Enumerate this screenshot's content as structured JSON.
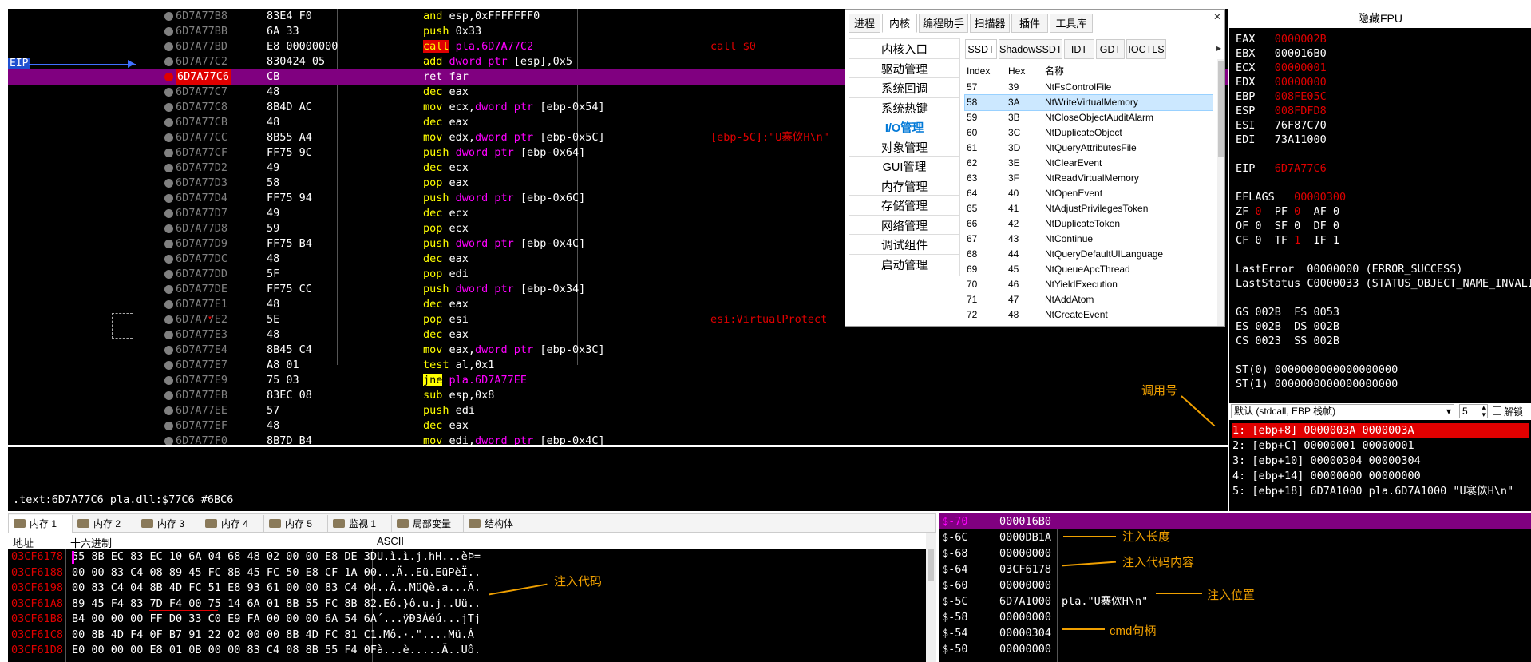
{
  "disasm": {
    "eip_label": "EIP",
    "rows": [
      {
        "addr": "6D7A77B8",
        "bytes": "83E4 F0",
        "asm": [
          [
            "kw",
            "and "
          ],
          [
            "",
            "esp,0xFFFFFFF0"
          ]
        ],
        "cmt": ""
      },
      {
        "addr": "6D7A77BB",
        "bytes": "6A 33",
        "asm": [
          [
            "kw",
            "push "
          ],
          [
            "",
            "0x33"
          ]
        ],
        "cmt": ""
      },
      {
        "addr": "6D7A77BD",
        "bytes": "E8 00000000",
        "asm": [
          [
            "kwbg",
            "call"
          ],
          [
            "",
            " "
          ],
          [
            "addrc",
            "pla.6D7A77C2"
          ]
        ],
        "cmt": "call $0"
      },
      {
        "addr": "6D7A77C2",
        "bytes": "830424 05",
        "asm": [
          [
            "kw",
            "add "
          ],
          [
            "reg",
            "dword ptr "
          ],
          [
            "",
            "[esp],0x5"
          ]
        ],
        "cmt": ""
      },
      {
        "addr": "6D7A77C6",
        "bytes": "CB",
        "asm": [
          [
            "kwpurp",
            "ret far"
          ]
        ],
        "cmt": "",
        "sel": true,
        "cur": true
      },
      {
        "addr": "6D7A77C7",
        "bytes": "48",
        "asm": [
          [
            "kw",
            "dec "
          ],
          [
            "",
            "eax"
          ]
        ],
        "cmt": ""
      },
      {
        "addr": "6D7A77C8",
        "bytes": "8B4D AC",
        "asm": [
          [
            "kw",
            "mov "
          ],
          [
            "",
            "ecx,"
          ],
          [
            "reg",
            "dword ptr "
          ],
          [
            "",
            "[ebp-0x54]"
          ]
        ],
        "cmt": ""
      },
      {
        "addr": "6D7A77CB",
        "bytes": "48",
        "asm": [
          [
            "kw",
            "dec "
          ],
          [
            "",
            "eax"
          ]
        ],
        "cmt": ""
      },
      {
        "addr": "6D7A77CC",
        "bytes": "8B55 A4",
        "asm": [
          [
            "kw",
            "mov "
          ],
          [
            "",
            "edx,"
          ],
          [
            "reg",
            "dword ptr "
          ],
          [
            "",
            "[ebp-0x5C]"
          ]
        ],
        "cmt": "[ebp-5C]:\"U褰佽H\\n\""
      },
      {
        "addr": "6D7A77CF",
        "bytes": "FF75 9C",
        "asm": [
          [
            "kw",
            "push "
          ],
          [
            "reg",
            "dword ptr "
          ],
          [
            "",
            "[ebp-0x64]"
          ]
        ],
        "cmt": ""
      },
      {
        "addr": "6D7A77D2",
        "bytes": "49",
        "asm": [
          [
            "kw",
            "dec "
          ],
          [
            "",
            "ecx"
          ]
        ],
        "cmt": ""
      },
      {
        "addr": "6D7A77D3",
        "bytes": "58",
        "asm": [
          [
            "kw",
            "pop "
          ],
          [
            "",
            "eax"
          ]
        ],
        "cmt": ""
      },
      {
        "addr": "6D7A77D4",
        "bytes": "FF75 94",
        "asm": [
          [
            "kw",
            "push "
          ],
          [
            "reg",
            "dword ptr "
          ],
          [
            "",
            "[ebp-0x6C]"
          ]
        ],
        "cmt": ""
      },
      {
        "addr": "6D7A77D7",
        "bytes": "49",
        "asm": [
          [
            "kw",
            "dec "
          ],
          [
            "",
            "ecx"
          ]
        ],
        "cmt": ""
      },
      {
        "addr": "6D7A77D8",
        "bytes": "59",
        "asm": [
          [
            "kw",
            "pop "
          ],
          [
            "",
            "ecx"
          ]
        ],
        "cmt": ""
      },
      {
        "addr": "6D7A77D9",
        "bytes": "FF75 B4",
        "asm": [
          [
            "kw",
            "push "
          ],
          [
            "reg",
            "dword ptr "
          ],
          [
            "",
            "[ebp-0x4C]"
          ]
        ],
        "cmt": ""
      },
      {
        "addr": "6D7A77DC",
        "bytes": "48",
        "asm": [
          [
            "kw",
            "dec "
          ],
          [
            "",
            "eax"
          ]
        ],
        "cmt": ""
      },
      {
        "addr": "6D7A77DD",
        "bytes": "5F",
        "asm": [
          [
            "kw",
            "pop "
          ],
          [
            "",
            "edi"
          ]
        ],
        "cmt": ""
      },
      {
        "addr": "6D7A77DE",
        "bytes": "FF75 CC",
        "asm": [
          [
            "kw",
            "push "
          ],
          [
            "reg",
            "dword ptr "
          ],
          [
            "",
            "[ebp-0x34]"
          ]
        ],
        "cmt": ""
      },
      {
        "addr": "6D7A77E1",
        "bytes": "48",
        "asm": [
          [
            "kw",
            "dec "
          ],
          [
            "",
            "eax"
          ]
        ],
        "cmt": ""
      },
      {
        "addr": "6D7A77E2",
        "bytes": "5E",
        "asm": [
          [
            "kw",
            "pop "
          ],
          [
            "",
            "esi"
          ]
        ],
        "cmt": "esi:VirtualProtect"
      },
      {
        "addr": "6D7A77E3",
        "bytes": "48",
        "asm": [
          [
            "kw",
            "dec "
          ],
          [
            "",
            "eax"
          ]
        ],
        "cmt": ""
      },
      {
        "addr": "6D7A77E4",
        "bytes": "8B45 C4",
        "asm": [
          [
            "kw",
            "mov "
          ],
          [
            "",
            "eax,"
          ],
          [
            "reg",
            "dword ptr "
          ],
          [
            "",
            "[ebp-0x3C]"
          ]
        ],
        "cmt": ""
      },
      {
        "addr": "6D7A77E7",
        "bytes": "A8 01",
        "asm": [
          [
            "kw",
            "test "
          ],
          [
            "",
            "al,0x1"
          ]
        ],
        "cmt": ""
      },
      {
        "addr": "6D7A77E9",
        "bytes": "75 03",
        "asm": [
          [
            "kwbg2",
            "jne"
          ],
          [
            "",
            " "
          ],
          [
            "addrc",
            "pla.6D7A77EE"
          ]
        ],
        "cmt": ""
      },
      {
        "addr": "6D7A77EB",
        "bytes": "83EC 08",
        "asm": [
          [
            "kw",
            "sub "
          ],
          [
            "",
            "esp,0x8"
          ]
        ],
        "cmt": ""
      },
      {
        "addr": "6D7A77EE",
        "bytes": "57",
        "asm": [
          [
            "kw",
            "push "
          ],
          [
            "",
            "edi"
          ]
        ],
        "cmt": ""
      },
      {
        "addr": "6D7A77EF",
        "bytes": "48",
        "asm": [
          [
            "kw",
            "dec "
          ],
          [
            "",
            "eax"
          ]
        ],
        "cmt": ""
      },
      {
        "addr": "6D7A77F0",
        "bytes": "8B7D B4",
        "asm": [
          [
            "kw",
            "mov "
          ],
          [
            "",
            "edi,"
          ],
          [
            "reg",
            "dword ptr "
          ],
          [
            "",
            "[ebp-0x4C]"
          ]
        ],
        "cmt": ""
      }
    ]
  },
  "info_line": ".text:6D7A77C6 pla.dll:$77C6 #6BC6",
  "kernel_panel": {
    "top_tabs": [
      "进程",
      "内核",
      "编程助手",
      "扫描器",
      "插件",
      "工具库"
    ],
    "left_nav": [
      "内核入口",
      "驱动管理",
      "系统回调",
      "系统热键",
      "I/O管理",
      "对象管理",
      "GUI管理",
      "内存管理",
      "存储管理",
      "网络管理",
      "调试组件",
      "启动管理"
    ],
    "sub_tabs": [
      "SSDT",
      "ShadowSSDT",
      "IDT",
      "GDT",
      "IOCTLS"
    ],
    "columns": [
      "Index",
      "Hex",
      "名称"
    ],
    "rows": [
      [
        "57",
        "39",
        "NtFsControlFile"
      ],
      [
        "58",
        "3A",
        "NtWriteVirtualMemory"
      ],
      [
        "59",
        "3B",
        "NtCloseObjectAuditAlarm"
      ],
      [
        "60",
        "3C",
        "NtDuplicateObject"
      ],
      [
        "61",
        "3D",
        "NtQueryAttributesFile"
      ],
      [
        "62",
        "3E",
        "NtClearEvent"
      ],
      [
        "63",
        "3F",
        "NtReadVirtualMemory"
      ],
      [
        "64",
        "40",
        "NtOpenEvent"
      ],
      [
        "65",
        "41",
        "NtAdjustPrivilegesToken"
      ],
      [
        "66",
        "42",
        "NtDuplicateToken"
      ],
      [
        "67",
        "43",
        "NtContinue"
      ],
      [
        "68",
        "44",
        "NtQueryDefaultUILanguage"
      ],
      [
        "69",
        "45",
        "NtQueueApcThread"
      ],
      [
        "70",
        "46",
        "NtYieldExecution"
      ],
      [
        "71",
        "47",
        "NtAddAtom"
      ],
      [
        "72",
        "48",
        "NtCreateEvent"
      ]
    ]
  },
  "fpu": {
    "title": "隐藏FPU",
    "regs": [
      [
        "EAX",
        "0000002B",
        true
      ],
      [
        "EBX",
        "000016B0",
        false
      ],
      [
        "ECX",
        "00000001",
        true
      ],
      [
        "EDX",
        "00000000",
        true
      ],
      [
        "EBP",
        "008FE05C",
        true
      ],
      [
        "ESP",
        "008FDFD8",
        true
      ],
      [
        "ESI",
        "76F87C70",
        false
      ],
      [
        "EDI",
        "73A11000",
        false
      ]
    ],
    "eip": [
      "EIP",
      "6D7A77C6"
    ],
    "eflags": [
      "EFLAGS",
      "00000300"
    ],
    "flags_lines": [
      [
        [
          "ZF ",
          ""
        ],
        [
          "0",
          "r"
        ],
        [
          "  PF ",
          ""
        ],
        [
          "0",
          "r"
        ],
        [
          "  AF 0",
          ""
        ]
      ],
      [
        [
          "OF 0  SF 0  DF 0",
          ""
        ]
      ],
      [
        [
          "CF 0  TF ",
          ""
        ],
        [
          "1",
          "r"
        ],
        [
          "  IF 1",
          ""
        ]
      ]
    ],
    "last_error": "LastError  00000000 (ERROR_SUCCESS)",
    "last_status": "LastStatus C0000033 (STATUS_OBJECT_NAME_INVALI",
    "seg_lines": [
      "GS 002B  FS 0053",
      "ES 002B  DS 002B",
      "CS 0023  SS 002B"
    ],
    "st_lines": [
      "ST(0) 0000000000000000000",
      "ST(1) 0000000000000000000"
    ]
  },
  "stack_ctl": {
    "callconv": "默认 (stdcall, EBP 栈帧)",
    "count": "5",
    "unlock": "解锁"
  },
  "stack_args": [
    "1: [ebp+8] 0000003A 0000003A",
    "2: [ebp+C] 00000001 00000001",
    "3: [ebp+10] 00000304 00000304",
    "4: [ebp+14] 00000000 00000000",
    "5: [ebp+18] 6D7A1000 pla.6D7A1000 \"U褰佽H\\n\""
  ],
  "mem_tabs": [
    "内存 1",
    "内存 2",
    "内存 3",
    "内存 4",
    "内存 5",
    "监视 1",
    "局部变量",
    "结构体"
  ],
  "mem_header": [
    "地址",
    "十六进制",
    "ASCII"
  ],
  "mem_rows": [
    [
      "03CF6178",
      "55 8B EC 83 EC 10 6A 04 68 48 02 00 00 E8 DE 3D",
      "U.ì.ì.j.hH...èÞ="
    ],
    [
      "03CF6188",
      "00 00 83 C4 08 89 45 FC 8B 45 FC 50 E8 CF 1A 00",
      "...Ä..Eü.EüPèÏ.."
    ],
    [
      "03CF6198",
      "00 83 C4 04 8B 4D FC 51 E8 93 61 00 00 83 C4 04",
      "..Ä..MüQè.a...Ä."
    ],
    [
      "03CF61A8",
      "89 45 F4 83 7D F4 00 75 14 6A 01 8B 55 FC 8B 82",
      ".Eô.}ô.u.j..Uü.."
    ],
    [
      "03CF61B8",
      "B4 00 00 00 FF D0 33 C0 E9 FA 00 00 00 6A 54 6A",
      "´...ÿÐ3Àéú...jTj"
    ],
    [
      "03CF61C8",
      "00 8B 4D F4 0F B7 91 22 02 00 00 8B 4D FC 81 C1",
      ".Mô.·.\"....Mü.Á"
    ],
    [
      "03CF61D8",
      "E0 00 00 00 E8 01 0B 00 00 83 C4 08 8B 55 F4 0F",
      "à...è.....Ä..Uô."
    ]
  ],
  "stack_rows": [
    [
      "$-70",
      "000016B0",
      ""
    ],
    [
      "$-6C",
      "0000DB1A",
      ""
    ],
    [
      "$-68",
      "00000000",
      ""
    ],
    [
      "$-64",
      "03CF6178",
      ""
    ],
    [
      "$-60",
      "00000000",
      ""
    ],
    [
      "$-5C",
      "6D7A1000",
      "pla.\"U褰佽H\\n\""
    ],
    [
      "$-58",
      "00000000",
      ""
    ],
    [
      "$-54",
      "00000304",
      ""
    ],
    [
      "$-50",
      "00000000",
      ""
    ]
  ],
  "annotations": {
    "call_no": "调用号",
    "inject_code": "注入代码",
    "inject_len": "注入长度",
    "inject_content": "注入代码内容",
    "inject_pos": "注入位置",
    "cmd_handle": "cmd句柄"
  }
}
